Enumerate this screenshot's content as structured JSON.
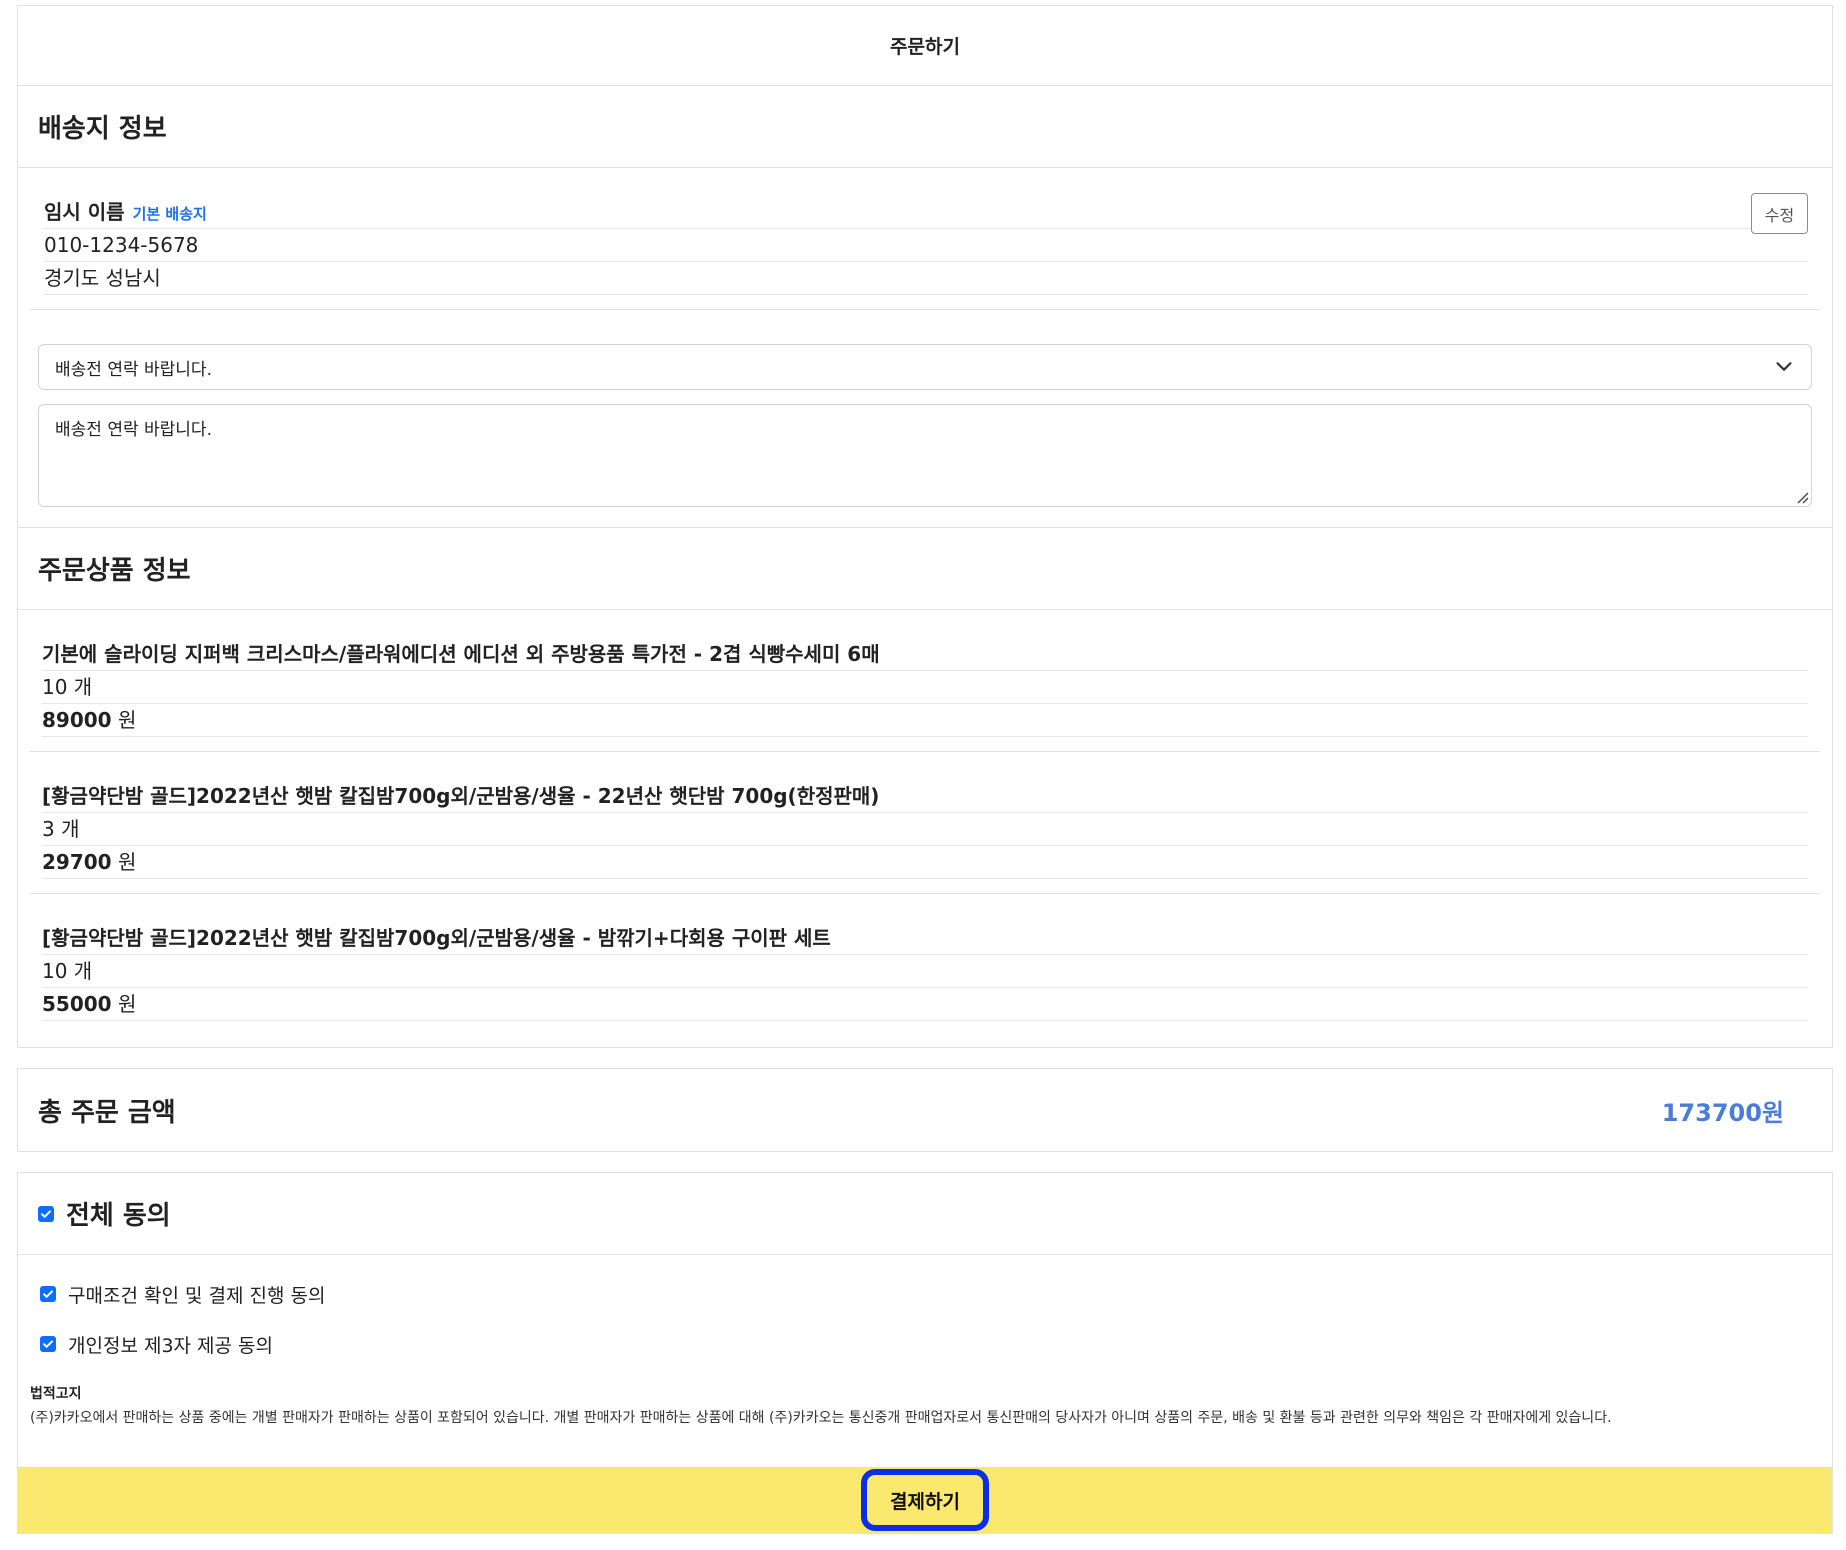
{
  "header": {
    "title": "주문하기"
  },
  "shipping": {
    "section_title": "배송지 정보",
    "name": "임시 이름",
    "badge": "기본 배송지",
    "phone": "010-1234-5678",
    "address": "경기도 성남시",
    "edit_label": "수정",
    "memo_selected": "배송전 연락 바랍니다.",
    "memo_text": "배송전 연락 바랍니다."
  },
  "products": {
    "section_title": "주문상품 정보",
    "items": [
      {
        "title": "기본에 슬라이딩 지퍼백 크리스마스/플라워에디션 에디션 외 주방용품 특가전 - 2겹 식빵수세미 6매",
        "qty": "10 개",
        "price": "89000",
        "unit": "원"
      },
      {
        "title": "[황금약단밤 골드]2022년산 햇밤 칼집밤700g외/군밤용/생율 - 22년산 햇단밤 700g(한정판매)",
        "qty": "3 개",
        "price": "29700",
        "unit": "원"
      },
      {
        "title": "[황금약단밤 골드]2022년산 햇밤 칼집밤700g외/군밤용/생율 - 밤깎기+다회용 구이판 세트",
        "qty": "10 개",
        "price": "55000",
        "unit": "원"
      }
    ]
  },
  "total": {
    "label": "총 주문 금액",
    "value": "173700원"
  },
  "agreement": {
    "all_label": "전체 동의",
    "items": [
      {
        "label": "구매조건 확인 및 결제 진행 동의",
        "checked": true
      },
      {
        "label": "개인정보 제3자 제공 동의",
        "checked": true
      }
    ],
    "legal_title": "법적고지",
    "legal_body": "(주)카카오에서 판매하는 상품 중에는 개별 판매자가 판매하는 상품이 포함되어 있습니다. 개별 판매자가 판매하는 상품에 대해 (주)카카오는 통신중개 판매업자로서 통신판매의 당사자가 아니며 상품의 주문, 배송 및 환불 등과 관련한 의무와 책임은 각 판매자에게 있습니다."
  },
  "pay": {
    "label": "결제하기"
  },
  "colors": {
    "accent_blue": "#4a7dd8",
    "pay_bar": "#fbe96f",
    "pay_focus": "#0b2ee6",
    "checkbox": "#0d6efd"
  }
}
